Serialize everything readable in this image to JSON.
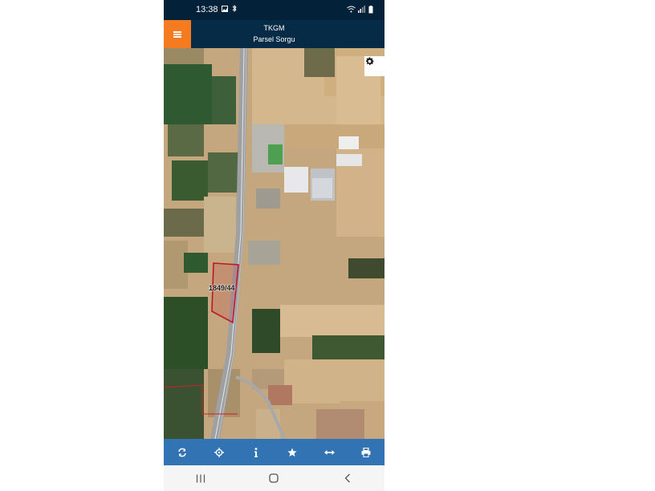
{
  "status_bar": {
    "time": "13:38",
    "left_icons": [
      "image-icon",
      "bluetooth-icon"
    ],
    "right_icons": [
      "wifi-icon",
      "signal-icon",
      "battery-icon"
    ]
  },
  "header": {
    "title": "TKGM",
    "subtitle": "Parsel Sorgu",
    "menu_icon": "hamburger-menu-icon",
    "accent_color": "#f47b20",
    "background_color": "#062b47"
  },
  "map": {
    "parcel_label": "1849/44",
    "parcel_outline_color": "#c0152a",
    "settings_icon": "gear-icon"
  },
  "toolbar": {
    "background_color": "#3273b3",
    "buttons": [
      {
        "icon": "refresh-icon"
      },
      {
        "icon": "locate-icon"
      },
      {
        "icon": "info-icon"
      },
      {
        "icon": "star-icon"
      },
      {
        "icon": "measure-icon"
      },
      {
        "icon": "print-icon"
      }
    ]
  },
  "nav_bar": {
    "buttons": [
      {
        "icon": "recent-apps-icon"
      },
      {
        "icon": "home-icon"
      },
      {
        "icon": "back-icon"
      }
    ]
  }
}
